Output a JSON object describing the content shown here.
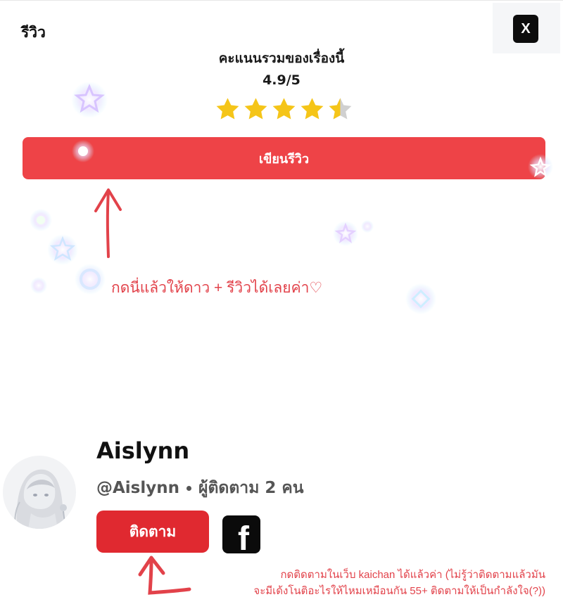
{
  "header": {
    "title": "รีวิว",
    "close_label": "X"
  },
  "rating": {
    "heading": "คะแนนรวมของเรื่องนี้",
    "score": "4.9/5",
    "stars": 4.5,
    "star_color": "#f5c518",
    "star_empty_color": "#d0d0d0"
  },
  "write_review": {
    "label": "เขียนรีวิว",
    "color": "#ee4347"
  },
  "annotations": {
    "review_hint": "กดนี่แล้วให้ดาว + รีวิวได้เลยค่า♡",
    "follow_hint_line1": "กดติดตามในเว็บ kaichan ได้แล้วค่า (ไม่รู้ว่าติดตามแล้วมัน",
    "follow_hint_line2": "จะมีเด้งโนติอะไรให้ไหมเหมือนกัน 55+ ติดตามให้เป็นกำลังใจ(?))",
    "color": "#e2424a"
  },
  "author": {
    "name": "Aislynn",
    "handle": "@Aislynn",
    "followers": "ผู้ติดตาม 2 คน",
    "follow_label": "ติดตาม",
    "facebook_icon": "f"
  }
}
